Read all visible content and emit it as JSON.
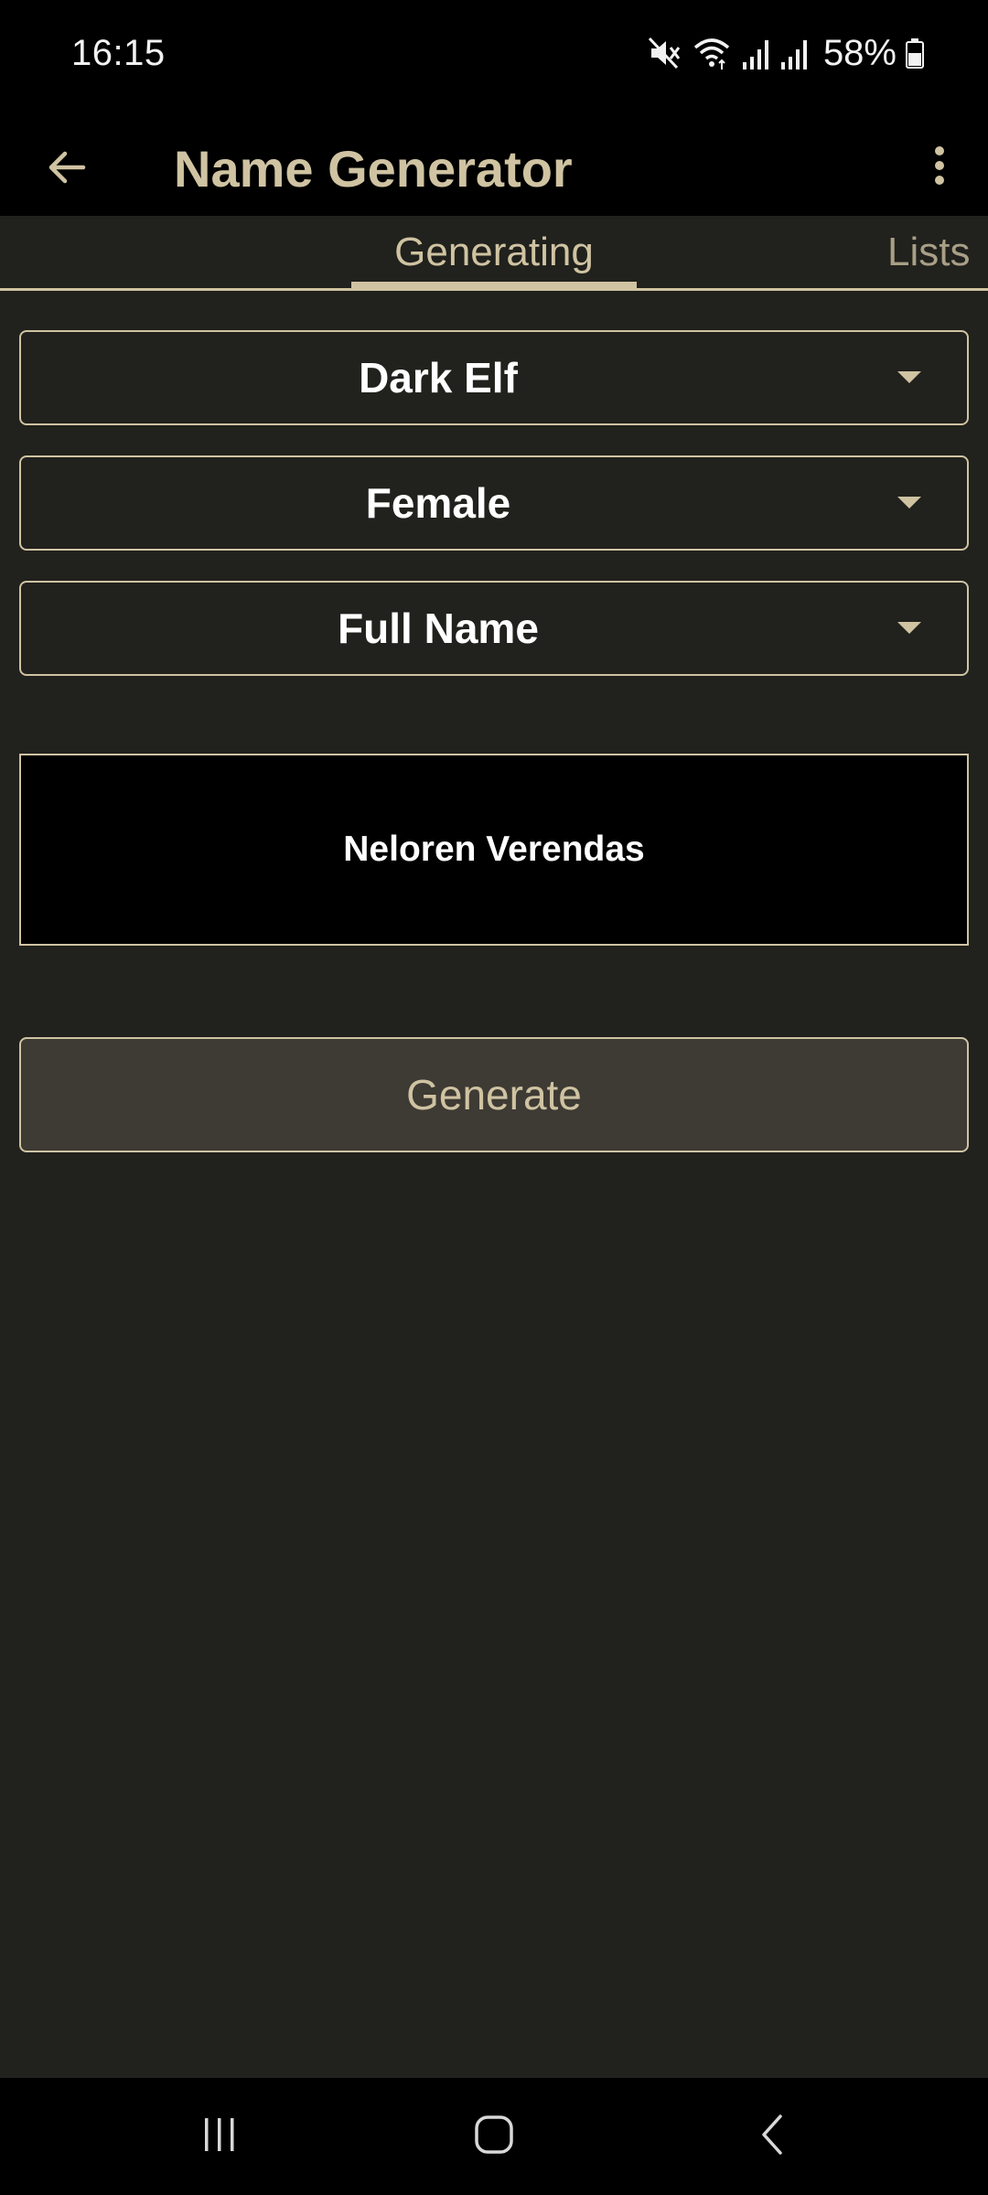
{
  "status_bar": {
    "time": "16:15",
    "battery": "58%",
    "icons": [
      "mute-icon",
      "wifi-icon",
      "signal-icon",
      "signal-icon",
      "battery-icon"
    ]
  },
  "app_bar": {
    "title": "Name Generator",
    "back_icon": "arrow-left-icon",
    "menu_icon": "more-vertical-icon"
  },
  "tabs": [
    {
      "label": "Generating",
      "selected": true
    },
    {
      "label": "Lists",
      "selected": false
    }
  ],
  "dropdowns": {
    "race": {
      "value": "Dark Elf"
    },
    "gender": {
      "value": "Female"
    },
    "name_type": {
      "value": "Full Name"
    }
  },
  "result": {
    "name": "Neloren Verendas"
  },
  "generate_button": {
    "label": "Generate"
  },
  "colors": {
    "accent": "#cfc3a2",
    "background": "#21211d",
    "button_fill": "#3e3a34",
    "result_fill": "#000000"
  }
}
